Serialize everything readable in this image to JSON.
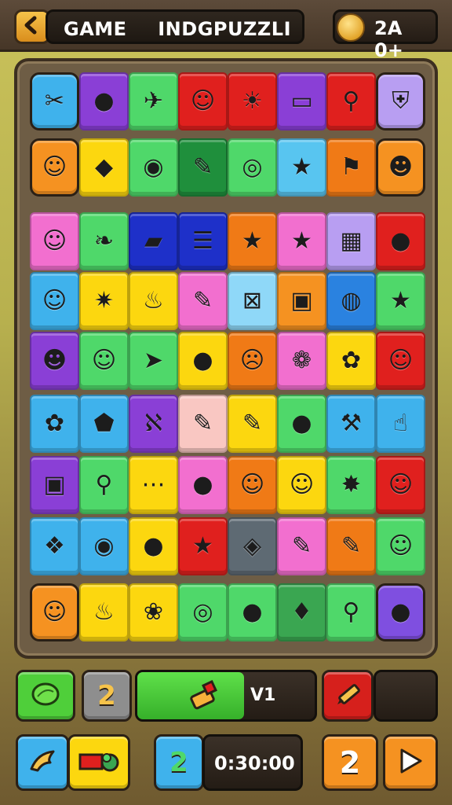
{
  "header": {
    "title_left": "GAME",
    "title_right": "INDGPUZZLI",
    "coins": "2A 0+",
    "back_icon": "back-arrow-icon",
    "coin_icon": "coin-face-icon"
  },
  "board": {
    "rows": [
      [
        {
          "color": "#3fb2ec",
          "icon": "✂",
          "name": "wrench-icon"
        },
        {
          "color": "#8a3fd6",
          "icon": "●",
          "name": "orange-leaf-icon"
        },
        {
          "color": "#4fd86a",
          "icon": "✈",
          "name": "plane-icon"
        },
        {
          "color": "#e0201e",
          "icon": "☺",
          "name": "robot-icon"
        },
        {
          "color": "#e0201e",
          "icon": "☀",
          "name": "sun-icon"
        },
        {
          "color": "#8a3fd6",
          "icon": "▭",
          "name": "sign-icon"
        },
        {
          "color": "#e0201e",
          "icon": "⚲",
          "name": "magnifier-icon"
        },
        {
          "color": "#b89ef2",
          "icon": "⛨",
          "name": "shield-icon"
        }
      ],
      [
        {
          "color": "#f59221",
          "icon": "☺",
          "name": "monkey-face-icon"
        },
        {
          "color": "#fcd70f",
          "icon": "◆",
          "name": "seed-icon"
        },
        {
          "color": "#4fd86a",
          "icon": "◉",
          "name": "plum-icon"
        },
        {
          "color": "#1f8f3c",
          "icon": "✎",
          "name": "pencil-icon"
        },
        {
          "color": "#4fd86a",
          "icon": "◎",
          "name": "ring-icon"
        },
        {
          "color": "#58c5f0",
          "icon": "★",
          "name": "star-face-icon"
        },
        {
          "color": "#f07a16",
          "icon": "⚑",
          "name": "flag-icon"
        },
        {
          "color": "#f59221",
          "icon": "☻",
          "name": "drop-face-icon"
        }
      ],
      [
        {
          "color": "#f26fcf",
          "icon": "☺",
          "name": "cat-face-icon"
        },
        {
          "color": "#4fd86a",
          "icon": "❧",
          "name": "leaf-icon"
        },
        {
          "color": "#1e30c9",
          "icon": "▰",
          "name": "flag-block-icon"
        },
        {
          "color": "#1e30c9",
          "icon": "☰",
          "name": "stripe-icon"
        },
        {
          "color": "#f07a16",
          "icon": "★",
          "name": "star-icon"
        },
        {
          "color": "#f26fcf",
          "icon": "★",
          "name": "smiling-star-icon"
        },
        {
          "color": "#b89ef2",
          "icon": "▦",
          "name": "calendar-icon"
        },
        {
          "color": "#e0201e",
          "icon": "●",
          "name": "cherry-icon"
        }
      ],
      [
        {
          "color": "#3fb2ec",
          "icon": "☺",
          "name": "frog-face-icon"
        },
        {
          "color": "#fcd70f",
          "icon": "✷",
          "name": "burst-icon"
        },
        {
          "color": "#fcd70f",
          "icon": "♨",
          "name": "drumstick-icon"
        },
        {
          "color": "#f26fcf",
          "icon": "✎",
          "name": "crayon-icon"
        },
        {
          "color": "#8fd8f8",
          "icon": "⊠",
          "name": "box-icon"
        },
        {
          "color": "#f59221",
          "icon": "▣",
          "name": "bag-icon"
        },
        {
          "color": "#2a82e0",
          "icon": "◍",
          "name": "bubble-icon"
        },
        {
          "color": "#4fd86a",
          "icon": "★",
          "name": "green-star-icon"
        }
      ],
      [
        {
          "color": "#8a3fd6",
          "icon": "☻",
          "name": "devil-face-icon"
        },
        {
          "color": "#4fd86a",
          "icon": "☺",
          "name": "blob-face-icon"
        },
        {
          "color": "#4fd86a",
          "icon": "➤",
          "name": "arrow-cursor-icon"
        },
        {
          "color": "#fcd70f",
          "icon": "●",
          "name": "balloon-icon"
        },
        {
          "color": "#f07a16",
          "icon": "☹",
          "name": "blue-face-icon"
        },
        {
          "color": "#f26fcf",
          "icon": "❁",
          "name": "strawberry-icon"
        },
        {
          "color": "#fcd70f",
          "icon": "✿",
          "name": "clover-icon"
        },
        {
          "color": "#e0201e",
          "icon": "☺",
          "name": "onion-face-icon"
        }
      ],
      [
        {
          "color": "#3fb2ec",
          "icon": "✿",
          "name": "palm-icon"
        },
        {
          "color": "#3fb2ec",
          "icon": "⬟",
          "name": "gem-icon"
        },
        {
          "color": "#8a3fd6",
          "icon": "ℵ",
          "name": "rune-icon"
        },
        {
          "color": "#f9c7c2",
          "icon": "✎",
          "name": "marker-icon"
        },
        {
          "color": "#fcd70f",
          "icon": "✎",
          "name": "yellow-crayon-icon"
        },
        {
          "color": "#4fd86a",
          "icon": "●",
          "name": "teal-balloon-icon"
        },
        {
          "color": "#3fb2ec",
          "icon": "⚒",
          "name": "tool-icon"
        },
        {
          "color": "#3fb2ec",
          "icon": "☝",
          "name": "hand-icon"
        }
      ],
      [
        {
          "color": "#8a3fd6",
          "icon": "▣",
          "name": "purse-icon"
        },
        {
          "color": "#4fd86a",
          "icon": "⚲",
          "name": "lens-icon"
        },
        {
          "color": "#fcd70f",
          "icon": "⋯",
          "name": "dots-card-icon"
        },
        {
          "color": "#f26fcf",
          "icon": "●",
          "name": "red-ball-icon"
        },
        {
          "color": "#f07a16",
          "icon": "☺",
          "name": "lime-face-icon"
        },
        {
          "color": "#fcd70f",
          "icon": "☺",
          "name": "smile-block-icon"
        },
        {
          "color": "#4fd86a",
          "icon": "✸",
          "name": "snowflake-icon"
        },
        {
          "color": "#e0201e",
          "icon": "☺",
          "name": "pear-face-icon"
        }
      ],
      [
        {
          "color": "#3fb2ec",
          "icon": "❖",
          "name": "pink-gem-icon"
        },
        {
          "color": "#3fb2ec",
          "icon": "◉",
          "name": "lollipop-icon"
        },
        {
          "color": "#fcd70f",
          "icon": "●",
          "name": "green-balloon-icon"
        },
        {
          "color": "#e0201e",
          "icon": "★",
          "name": "red-star-icon"
        },
        {
          "color": "#5e6a73",
          "icon": "◈",
          "name": "card-icon"
        },
        {
          "color": "#f26fcf",
          "icon": "✎",
          "name": "red-crayon-icon"
        },
        {
          "color": "#f07a16",
          "icon": "✎",
          "name": "orange-pencil-icon"
        },
        {
          "color": "#4fd86a",
          "icon": "☺",
          "name": "dino-icon"
        }
      ],
      [
        {
          "color": "#f59221",
          "icon": "☺",
          "name": "flame-face-icon"
        },
        {
          "color": "#fcd70f",
          "icon": "♨",
          "name": "chicken-leg-icon"
        },
        {
          "color": "#fcd70f",
          "icon": "❀",
          "name": "cloud-flower-icon"
        },
        {
          "color": "#4fd86a",
          "icon": "◎",
          "name": "spiral-icon"
        },
        {
          "color": "#4fd86a",
          "icon": "●",
          "name": "berry-icon"
        },
        {
          "color": "#3aa651",
          "icon": "♦",
          "name": "drop-dots-icon"
        },
        {
          "color": "#4fd86a",
          "icon": "⚲",
          "name": "racket-icon"
        },
        {
          "color": "#7f4fe0",
          "icon": "●",
          "name": "tomato-icon"
        }
      ]
    ]
  },
  "controls": {
    "row1": {
      "lime_icon": "lime-icon",
      "count_a": "2",
      "brush_icon": "brush-icon",
      "version": "V1",
      "crayon_icon": "crayon-icon"
    },
    "row2": {
      "bird_icon": "bird-icon",
      "gift_icon": "gift-icon",
      "count_b": "2",
      "timer": "0:30:00",
      "count_c": "2",
      "play_icon": "play-icon"
    }
  }
}
